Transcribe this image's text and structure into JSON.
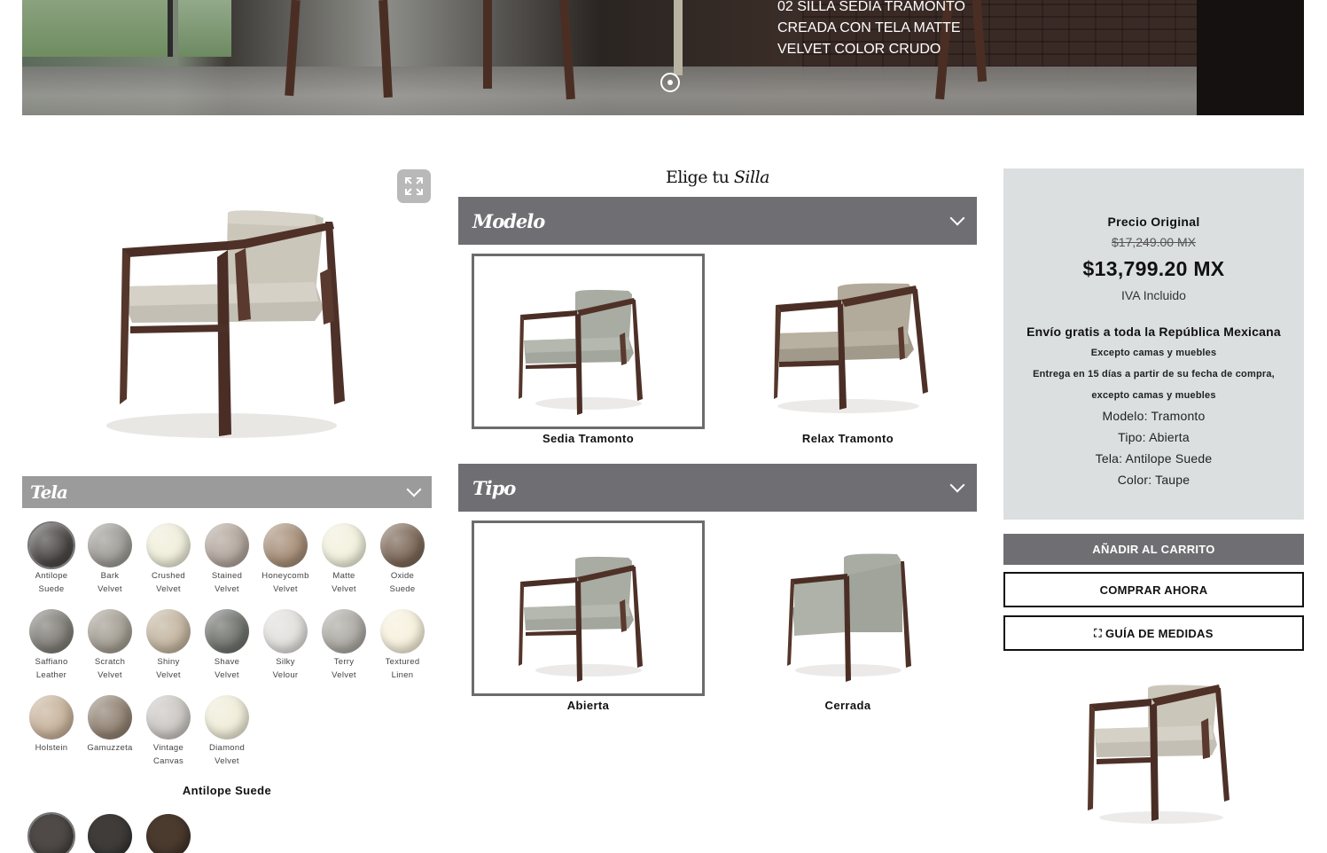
{
  "hero": {
    "caption": "02 SILLA SEDIA TRAMONTO CREADA CON TELA MATTE VELVET COLOR CRUDO"
  },
  "configurator": {
    "title_prefix": "Elige tu",
    "title_emphasis": "Silla"
  },
  "tela": {
    "header": "Tela",
    "selected_name": "Antilope Suede",
    "swatches": [
      {
        "line1": "Antilope",
        "line2": "Suede",
        "color": "#4a4645"
      },
      {
        "line1": "Bark",
        "line2": "Velvet",
        "color": "#9c9a94"
      },
      {
        "line1": "Crushed",
        "line2": "Velvet",
        "color": "#efedd9"
      },
      {
        "line1": "Stained",
        "line2": "Velvet",
        "color": "#b0a49b"
      },
      {
        "line1": "Honeycomb",
        "line2": "Velvet",
        "color": "#a58c76"
      },
      {
        "line1": "Matte",
        "line2": "Velvet",
        "color": "#f2f0dc"
      },
      {
        "line1": "Oxide",
        "line2": "Suede",
        "color": "#7a6656"
      },
      {
        "line1": "Saffiano",
        "line2": "Leather",
        "color": "#7f7c76"
      },
      {
        "line1": "Scratch",
        "line2": "Velvet",
        "color": "#a29c91"
      },
      {
        "line1": "Shiny",
        "line2": "Velvet",
        "color": "#c2b49e"
      },
      {
        "line1": "Shave",
        "line2": "Velvet",
        "color": "#6e706b"
      },
      {
        "line1": "Silky",
        "line2": "Velour",
        "color": "#e0dfdc"
      },
      {
        "line1": "Terry",
        "line2": "Velvet",
        "color": "#aba8a2"
      },
      {
        "line1": "Textured",
        "line2": "Linen",
        "color": "#f6f0dc"
      },
      {
        "line1": "Holstein",
        "line2": "",
        "color": "#c6b19a"
      },
      {
        "line1": "Gamuzzeta",
        "line2": "",
        "color": "#8f8070"
      },
      {
        "line1": "Vintage",
        "line2": "Canvas",
        "color": "#cac6c2"
      },
      {
        "line1": "Diamond",
        "line2": "Velvet",
        "color": "#efecd7"
      }
    ],
    "colors": [
      "#4f4a47",
      "#3f3c3a",
      "#4b3a2e"
    ]
  },
  "modelo": {
    "header": "Modelo",
    "options": [
      {
        "label": "Sedia Tramonto",
        "selected": true
      },
      {
        "label": "Relax Tramonto",
        "selected": false
      }
    ]
  },
  "tipo": {
    "header": "Tipo",
    "options": [
      {
        "label": "Abierta",
        "selected": true
      },
      {
        "label": "Cerrada",
        "selected": false
      }
    ]
  },
  "price": {
    "original_label": "Precio Original",
    "original_price": "$17,249.00 MX",
    "current_price": "$13,799.20 MX",
    "iva": "IVA Incluido",
    "shipping": "Envío gratis a toda la República Mexicana",
    "note1": "Excepto camas y muebles",
    "note2": "Entrega en 15 días a partir de su fecha de compra,",
    "note3": "excepto camas y muebles",
    "spec_modelo": "Modelo: Tramonto",
    "spec_tipo": "Tipo: Abierta",
    "spec_tela": "Tela: Antilope Suede",
    "spec_color": "Color: Taupe"
  },
  "buttons": {
    "add_to_cart": "AÑADIR AL CARRITO",
    "buy_now": "COMPRAR AHORA",
    "size_guide": "GUÍA DE MEDIDAS"
  },
  "icons": {
    "expand": "expand-icon",
    "chevron": "chevron-down-icon",
    "guide": "ruler-icon",
    "slider_dot": "slider-dot-icon"
  }
}
